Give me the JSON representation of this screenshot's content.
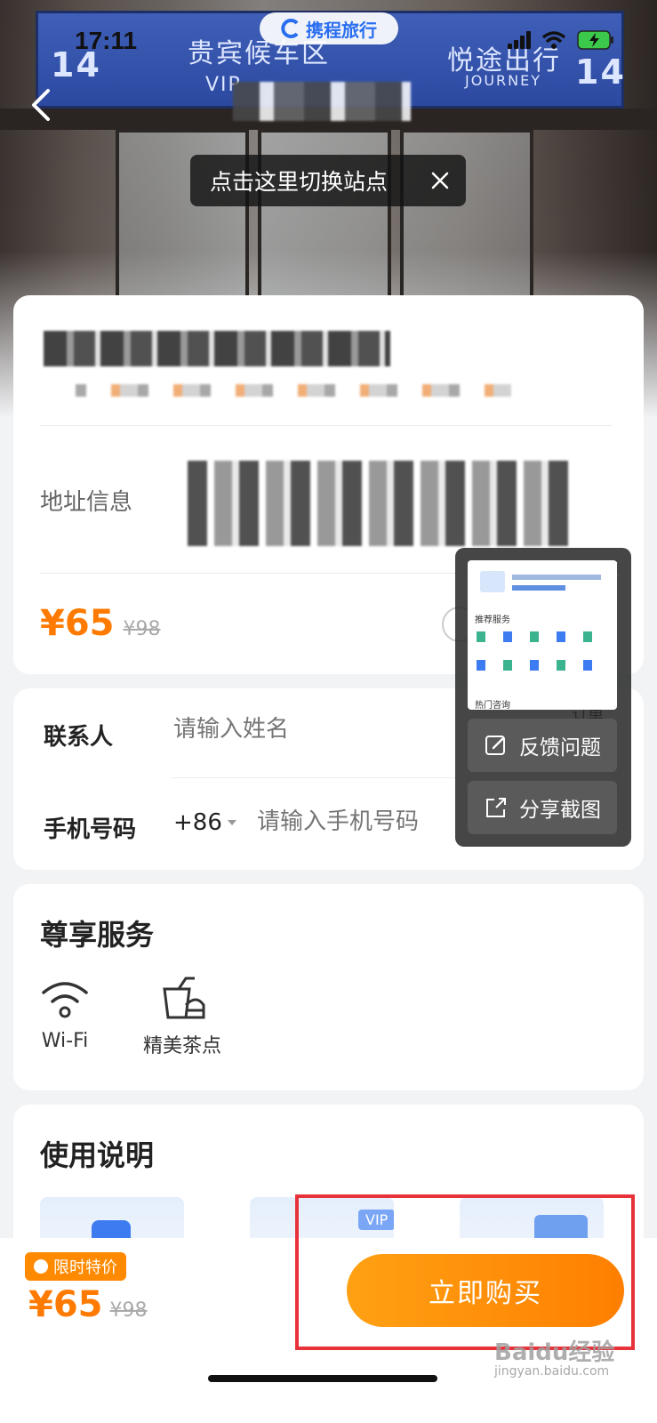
{
  "status_bar": {
    "time": "17:11"
  },
  "brand": {
    "name": "携程旅行"
  },
  "hero": {
    "sign_left_top": "贵宾候车区",
    "sign_left_vip": "VIP",
    "sign_left_num": "14",
    "sign_right_top": "悦途出行",
    "sign_right_sub": "JOURNEY",
    "sign_right_num": "14"
  },
  "station_tip": {
    "text": "点击这里切换站点"
  },
  "product": {
    "address_label": "地址信息",
    "price": "¥65",
    "original_price": "¥98"
  },
  "contact": {
    "name_label": "联系人",
    "name_placeholder": "请输入姓名",
    "phone_label": "手机号码",
    "country_code": "+86",
    "phone_placeholder": "请输入手机号码",
    "side_text": "订单"
  },
  "services": {
    "title": "尊享服务",
    "items": [
      {
        "label": "Wi-Fi",
        "icon": "wifi-icon"
      },
      {
        "label": "精美茶点",
        "icon": "tea-snack-icon"
      }
    ]
  },
  "guide": {
    "title": "使用说明",
    "badge": "VIP"
  },
  "feedback_panel": {
    "feedback_label": "反馈问题",
    "share_label": "分享截图",
    "preview_section": "推荐服务",
    "preview_footer": "热门咨询"
  },
  "bottom_bar": {
    "promo_badge": "限时特价",
    "price": "¥65",
    "original_price": "¥98",
    "buy_label": "立即购买"
  },
  "watermark": {
    "text": "Baidu经验",
    "sub": "jingyan.baidu.com"
  },
  "colors": {
    "accent": "#ff7a00",
    "highlight": "#e8323a",
    "brand": "#2a6ef0"
  }
}
